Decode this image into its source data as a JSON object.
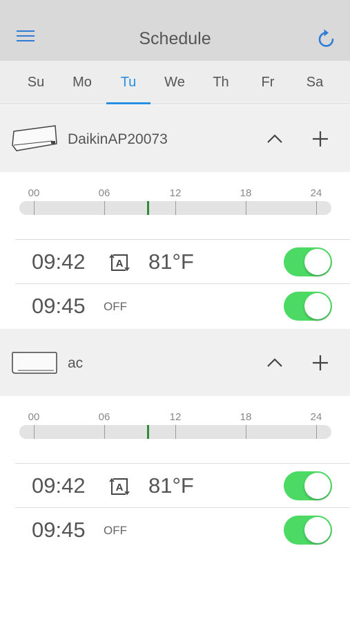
{
  "header": {
    "title": "Schedule",
    "menu_icon": "hamburger-menu-icon",
    "refresh_icon": "refresh-icon",
    "accent_color": "#2e7cd6"
  },
  "days": {
    "items": [
      "Su",
      "Mo",
      "Tu",
      "We",
      "Th",
      "Fr",
      "Sa"
    ],
    "selected": "Tu",
    "selected_color": "#2a8ee0"
  },
  "timeline_labels": [
    "00",
    "06",
    "12",
    "18",
    "24"
  ],
  "current_time_marker_hours": 9.7,
  "devices": [
    {
      "name": "DaikinAP20073",
      "icon": "air-conditioner-icon",
      "collapse_icon": "chevron-up-icon",
      "add_icon": "plus-icon",
      "entries": [
        {
          "time": "09:42",
          "mode_icon": "auto-mode-icon",
          "temperature": "81°F",
          "enabled": true
        },
        {
          "time": "09:45",
          "state": "OFF",
          "enabled": true
        }
      ]
    },
    {
      "name": "ac",
      "icon": "air-conditioner-icon",
      "collapse_icon": "chevron-up-icon",
      "add_icon": "plus-icon",
      "entries": [
        {
          "time": "09:42",
          "mode_icon": "auto-mode-icon",
          "temperature": "81°F",
          "enabled": true
        },
        {
          "time": "09:45",
          "state": "OFF",
          "enabled": true
        }
      ]
    }
  ],
  "toggle_on_color": "#4cd964"
}
